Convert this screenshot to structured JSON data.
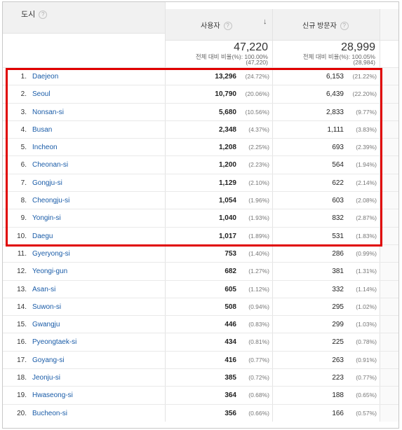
{
  "header": {
    "city_label": "도시",
    "users_label": "사용자",
    "new_visitors_label": "신규 방문자",
    "help_glyph": "?",
    "sort_glyph": "↓"
  },
  "totals": {
    "users": {
      "value": "47,220",
      "ratio_line": "전체 대비 비율(%): 100.00%",
      "detail": "(47,220)"
    },
    "new_visitors": {
      "value": "28,999",
      "ratio_line": "전체 대비 비율(%): 100.05%",
      "detail": "(28,984)"
    }
  },
  "rows": [
    {
      "rank": "1.",
      "city": "Daejeon",
      "users": "13,296",
      "users_pct": "(24.72%)",
      "new": "6,153",
      "new_pct": "(21.22%)"
    },
    {
      "rank": "2.",
      "city": "Seoul",
      "users": "10,790",
      "users_pct": "(20.06%)",
      "new": "6,439",
      "new_pct": "(22.20%)"
    },
    {
      "rank": "3.",
      "city": "Nonsan-si",
      "users": "5,680",
      "users_pct": "(10.56%)",
      "new": "2,833",
      "new_pct": "(9.77%)"
    },
    {
      "rank": "4.",
      "city": "Busan",
      "users": "2,348",
      "users_pct": "(4.37%)",
      "new": "1,111",
      "new_pct": "(3.83%)"
    },
    {
      "rank": "5.",
      "city": "Incheon",
      "users": "1,208",
      "users_pct": "(2.25%)",
      "new": "693",
      "new_pct": "(2.39%)"
    },
    {
      "rank": "6.",
      "city": "Cheonan-si",
      "users": "1,200",
      "users_pct": "(2.23%)",
      "new": "564",
      "new_pct": "(1.94%)"
    },
    {
      "rank": "7.",
      "city": "Gongju-si",
      "users": "1,129",
      "users_pct": "(2.10%)",
      "new": "622",
      "new_pct": "(2.14%)"
    },
    {
      "rank": "8.",
      "city": "Cheongju-si",
      "users": "1,054",
      "users_pct": "(1.96%)",
      "new": "603",
      "new_pct": "(2.08%)"
    },
    {
      "rank": "9.",
      "city": "Yongin-si",
      "users": "1,040",
      "users_pct": "(1.93%)",
      "new": "832",
      "new_pct": "(2.87%)"
    },
    {
      "rank": "10.",
      "city": "Daegu",
      "users": "1,017",
      "users_pct": "(1.89%)",
      "new": "531",
      "new_pct": "(1.83%)"
    },
    {
      "rank": "11.",
      "city": "Gyeryong-si",
      "users": "753",
      "users_pct": "(1.40%)",
      "new": "286",
      "new_pct": "(0.99%)"
    },
    {
      "rank": "12.",
      "city": "Yeongi-gun",
      "users": "682",
      "users_pct": "(1.27%)",
      "new": "381",
      "new_pct": "(1.31%)"
    },
    {
      "rank": "13.",
      "city": "Asan-si",
      "users": "605",
      "users_pct": "(1.12%)",
      "new": "332",
      "new_pct": "(1.14%)"
    },
    {
      "rank": "14.",
      "city": "Suwon-si",
      "users": "508",
      "users_pct": "(0.94%)",
      "new": "295",
      "new_pct": "(1.02%)"
    },
    {
      "rank": "15.",
      "city": "Gwangju",
      "users": "446",
      "users_pct": "(0.83%)",
      "new": "299",
      "new_pct": "(1.03%)"
    },
    {
      "rank": "16.",
      "city": "Pyeongtaek-si",
      "users": "434",
      "users_pct": "(0.81%)",
      "new": "225",
      "new_pct": "(0.78%)"
    },
    {
      "rank": "17.",
      "city": "Goyang-si",
      "users": "416",
      "users_pct": "(0.77%)",
      "new": "263",
      "new_pct": "(0.91%)"
    },
    {
      "rank": "18.",
      "city": "Jeonju-si",
      "users": "385",
      "users_pct": "(0.72%)",
      "new": "223",
      "new_pct": "(0.77%)"
    },
    {
      "rank": "19.",
      "city": "Hwaseong-si",
      "users": "364",
      "users_pct": "(0.68%)",
      "new": "188",
      "new_pct": "(0.65%)"
    },
    {
      "rank": "20.",
      "city": "Bucheon-si",
      "users": "356",
      "users_pct": "(0.66%)",
      "new": "166",
      "new_pct": "(0.57%)"
    }
  ],
  "colors": {
    "highlight": "#e00000",
    "link": "#1a5ca8",
    "header_bg": "#f1f1f1"
  }
}
